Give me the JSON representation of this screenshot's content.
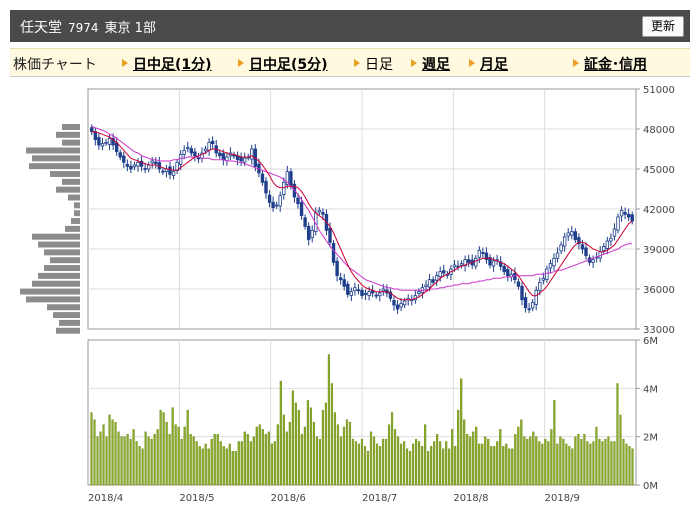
{
  "header": {
    "name": "任天堂",
    "code": "7974",
    "market": "東京 1部",
    "refresh_label": "更新"
  },
  "nav": {
    "label": "株価チャート",
    "items": [
      {
        "label": "日中足(1分)",
        "link": true
      },
      {
        "label": "日中足(5分)",
        "link": true
      },
      {
        "label": "日足",
        "link": false
      },
      {
        "label": "週足",
        "link": true
      },
      {
        "label": "月足",
        "link": true
      },
      {
        "label": "証金･信用",
        "link": true
      }
    ]
  },
  "colors": {
    "candle": "#1e3f8c",
    "ma_short": "#cc0033",
    "ma_long": "#cc33cc",
    "volume": "#8aaa2a",
    "volume_profile": "#8c8c8c"
  },
  "chart_data": [
    {
      "type": "candlestick",
      "x_labels": [
        "2018/4",
        "2018/5",
        "2018/6",
        "2018/7",
        "2018/8",
        "2018/9"
      ],
      "ylim": [
        33000,
        51000
      ],
      "yticks": [
        "51000",
        "48000",
        "45000",
        "42000",
        "39000",
        "36000",
        "33000"
      ],
      "series": [
        {
          "role": "close",
          "values": [
            47800,
            47200,
            46800,
            46900,
            47000,
            47300,
            46800,
            46300,
            45900,
            45500,
            45200,
            45000,
            45300,
            45500,
            45200,
            45000,
            45300,
            45600,
            45400,
            45000,
            44800,
            45000,
            44600,
            44800,
            45500,
            46100,
            46400,
            46600,
            46200,
            46000,
            45800,
            46200,
            46500,
            47000,
            46900,
            46200,
            46000,
            45700,
            45900,
            46200,
            46000,
            45700,
            45600,
            45800,
            45900,
            46500,
            45200,
            44700,
            44000,
            43200,
            42500,
            42100,
            42300,
            43000,
            44000,
            44800,
            43700,
            42900,
            42400,
            41500,
            40700,
            39700,
            40400,
            41700,
            41900,
            41600,
            40400,
            39500,
            38000,
            37000,
            36700,
            36200,
            35600,
            35800,
            36100,
            35900,
            35500,
            35600,
            35800,
            35700,
            35500,
            35700,
            36000,
            35700,
            35300,
            34800,
            34500,
            34900,
            35100,
            35300,
            35200,
            35500,
            35800,
            36100,
            36300,
            36700,
            36500,
            37000,
            37300,
            37200,
            37100,
            37500,
            37800,
            37700,
            37900,
            38200,
            38000,
            37800,
            38300,
            38900,
            38700,
            38200,
            37800,
            38100,
            38200,
            37700,
            37300,
            37000,
            37100,
            36700,
            36200,
            35200,
            34600,
            34500,
            35000,
            35900,
            36500,
            36800,
            37500,
            37900,
            38300,
            38700,
            39300,
            39900,
            40200,
            40300,
            39700,
            39400,
            39000,
            38500,
            38000,
            38200,
            38400,
            38800,
            39200,
            39600,
            39800,
            40500,
            41400,
            41900,
            41600,
            41400,
            41100
          ]
        },
        {
          "role": "ma_short",
          "values": [
            47800,
            47800,
            47700,
            47600,
            47500,
            47400,
            47200,
            47000,
            46700,
            46400,
            46100,
            45800,
            45700,
            45600,
            45500,
            45400,
            45300,
            45300,
            45300,
            45200,
            45100,
            45000,
            45000,
            44900,
            44900,
            45100,
            45300,
            45500,
            45700,
            45900,
            46000,
            46100,
            46200,
            46400,
            46500,
            46500,
            46400,
            46300,
            46200,
            46100,
            46100,
            46000,
            45900,
            45900,
            45900,
            46000,
            45800,
            45600,
            45300,
            44900,
            44500,
            44000,
            43700,
            43600,
            43600,
            43700,
            43700,
            43700,
            43600,
            43300,
            42900,
            42400,
            42000,
            41700,
            41500,
            41300,
            41000,
            40700,
            40200,
            39600,
            39000,
            38400,
            37800,
            37300,
            36900,
            36600,
            36300,
            36100,
            36000,
            35900,
            35800,
            35800,
            35800,
            35800,
            35700,
            35500,
            35300,
            35200,
            35200,
            35200,
            35200,
            35300,
            35400,
            35600,
            35800,
            36000,
            36300,
            36500,
            36800,
            37000,
            37100,
            37300,
            37400,
            37600,
            37700,
            37800,
            37900,
            38000,
            38100,
            38200,
            38300,
            38300,
            38300,
            38200,
            38100,
            38000,
            37900,
            37700,
            37500,
            37300,
            37000,
            36600,
            36200,
            35800,
            35500,
            35500,
            35700,
            35900,
            36200,
            36600,
            37000,
            37400,
            37800,
            38200,
            38600,
            39000,
            39300,
            39500,
            39500,
            39400,
            39200,
            39000,
            38900,
            38800,
            38800,
            38900,
            39100,
            39300,
            39700,
            40100,
            40500,
            40900,
            41100
          ]
        },
        {
          "role": "ma_long",
          "values": [
            48200,
            48100,
            48000,
            47900,
            47800,
            47600,
            47500,
            47300,
            47100,
            46900,
            46700,
            46500,
            46300,
            46200,
            46000,
            45900,
            45800,
            45700,
            45700,
            45600,
            45600,
            45600,
            45600,
            45700,
            45700,
            45800,
            45800,
            45900,
            45900,
            45900,
            45900,
            45800,
            45800,
            45800,
            45700,
            45700,
            45700,
            45700,
            45600,
            45600,
            45600,
            45500,
            45500,
            45400,
            45300,
            45200,
            45100,
            45000,
            44900,
            44800,
            44700,
            44600,
            44500,
            44400,
            44200,
            44000,
            43700,
            43400,
            43100,
            42700,
            42300,
            41900,
            41400,
            40900,
            40400,
            40000,
            39600,
            39200,
            38900,
            38600,
            38300,
            38000,
            37700,
            37500,
            37300,
            37100,
            36900,
            36700,
            36600,
            36500,
            36400,
            36300,
            36200,
            36100,
            36100,
            36000,
            36000,
            35900,
            35900,
            35900,
            35900,
            35900,
            35900,
            35900,
            35900,
            36000,
            36000,
            36000,
            36100,
            36100,
            36200,
            36200,
            36300,
            36300,
            36400,
            36400,
            36400,
            36500,
            36500,
            36600,
            36600,
            36700,
            36700,
            36800,
            36800,
            36800,
            36900,
            36900,
            36900,
            37000,
            37000,
            37000,
            37000,
            37000,
            37000,
            37100,
            37100,
            37100,
            37200,
            37200,
            37300,
            37400,
            37400,
            37500,
            37600,
            37700,
            37800,
            37900,
            38000,
            38100,
            38200,
            38300,
            38400,
            38500,
            38600,
            38700,
            38800,
            38900,
            39000,
            39200,
            39300,
            39400,
            39400
          ]
        }
      ]
    },
    {
      "type": "bar",
      "ylim": [
        0,
        6000000
      ],
      "yticks": [
        "6M",
        "4M",
        "2M",
        "0M"
      ],
      "values": [
        3.0,
        2.7,
        2.0,
        2.2,
        2.5,
        2.0,
        2.9,
        2.7,
        2.6,
        2.2,
        2.0,
        2.0,
        2.1,
        1.9,
        2.3,
        1.8,
        1.6,
        1.5,
        2.2,
        2.0,
        1.9,
        2.1,
        2.3,
        3.1,
        3.0,
        2.6,
        2.1,
        3.2,
        2.5,
        2.4,
        1.9,
        2.4,
        3.1,
        2.1,
        2.0,
        1.8,
        1.6,
        1.5,
        1.7,
        1.5,
        1.9,
        2.1,
        2.1,
        1.8,
        1.6,
        1.5,
        1.7,
        1.4,
        1.4,
        1.8,
        1.8,
        2.2,
        2.1,
        1.8,
        2.0,
        2.4,
        2.5,
        2.3,
        2.1,
        2.2,
        1.7,
        1.8,
        2.5,
        4.3,
        2.9,
        2.2,
        2.6,
        3.9,
        3.4,
        3.1,
        2.1,
        2.4,
        3.5,
        3.2,
        2.6,
        2.0,
        1.9,
        3.1,
        3.4,
        5.4,
        4.2,
        3.0,
        2.5,
        2.0,
        2.4,
        2.7,
        2.6,
        1.9,
        1.8,
        1.7,
        1.9,
        1.6,
        1.4,
        2.2,
        2.0,
        1.7,
        1.6,
        1.9,
        1.9,
        2.5,
        3.0,
        2.3,
        2.0,
        1.7,
        1.8,
        1.5,
        1.4,
        1.7,
        1.9,
        1.8,
        1.6,
        2.5,
        1.4,
        1.6,
        1.8,
        2.1,
        1.8,
        1.5,
        1.8,
        1.5,
        2.3,
        1.6,
        3.1,
        4.4,
        2.7,
        2.1,
        2.0,
        2.2,
        2.4,
        1.7,
        1.7,
        2.0,
        1.9,
        1.6,
        1.6,
        1.8,
        2.3,
        1.6,
        1.7,
        1.5,
        1.5,
        2.1,
        2.4,
        2.7,
        2.0,
        1.9,
        2.0,
        2.2,
        2.0,
        1.8,
        1.7,
        1.9,
        1.8,
        2.3,
        3.5,
        1.7,
        2.0,
        1.9,
        1.7,
        1.6,
        1.5,
        2.0,
        2.1,
        1.9,
        2.1,
        1.8,
        1.7,
        1.8,
        2.4,
        1.9,
        1.8,
        1.9,
        2.0,
        1.8,
        1.8,
        4.2,
        2.9,
        1.9,
        1.7,
        1.6,
        1.5
      ]
    },
    {
      "type": "bar",
      "orientation": "horizontal",
      "note_ref": "volume profile",
      "values": [
        0.3,
        0.4,
        0.3,
        0.9,
        0.8,
        0.85,
        0.5,
        0.3,
        0.4,
        0.2,
        0.1,
        0.1,
        0.15,
        0.25,
        0.8,
        0.7,
        0.6,
        0.5,
        0.6,
        0.7,
        0.8,
        1.0,
        0.9,
        0.55,
        0.45,
        0.35,
        0.4
      ]
    }
  ]
}
